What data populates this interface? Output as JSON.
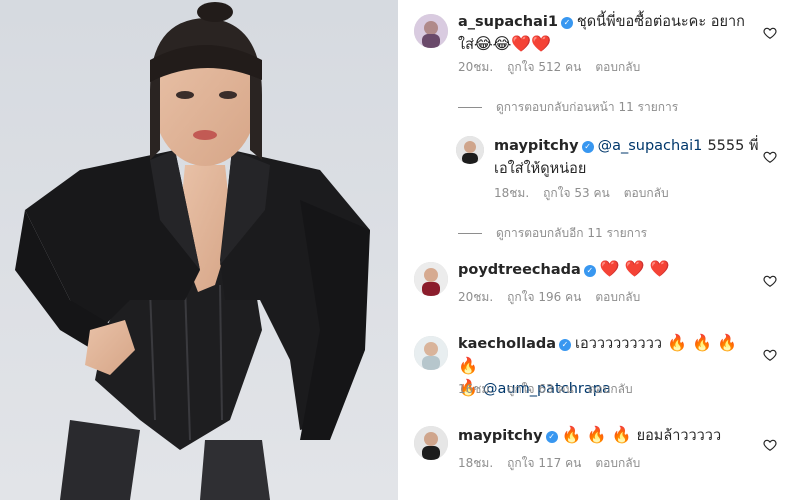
{
  "comments": [
    {
      "username": "a_supachai1",
      "text_line1": "ชุดนี้พี่ขอซื้อต่อนะคะ อยาก",
      "text_line2": "ใส่",
      "emojis": "😂😂",
      "hearts": "❤️❤️",
      "time": "20ชม.",
      "likes": "ถูกใจ 512 คน",
      "reply": "ตอบกลับ",
      "view_replies": "ดูการตอบกลับก่อนหน้า 11 รายการ"
    },
    {
      "username": "maypitchy",
      "mention": "@a_supachai1",
      "text_line1": "5555 พี่",
      "text_line2": "เอใส่ให้ดูหน่อย",
      "time": "18ชม.",
      "likes": "ถูกใจ 53 คน",
      "reply": "ตอบกลับ",
      "view_replies": "ดูการตอบกลับอีก 11 รายการ"
    },
    {
      "username": "poydtreechada",
      "hearts": "❤️ ❤️ ❤️",
      "time": "20ชม.",
      "likes": "ถูกใจ 196 คน",
      "reply": "ตอบกลับ"
    },
    {
      "username": "kaechollada",
      "text_line1": "เอววววววววว",
      "fires_line1": "🔥 🔥 🔥 🔥",
      "fires_line2": "🔥",
      "mention": "@aum_patchrapa",
      "time": "16ชม.",
      "likes": "ถูกใจ 63 คน",
      "reply": "ตอบกลับ"
    },
    {
      "username": "maypitchy",
      "fires": "🔥 🔥 🔥",
      "text_line1": "ยอมล้าววววว",
      "time": "18ชม.",
      "likes": "ถูกใจ 117 คน",
      "reply": "ตอบกลับ"
    }
  ],
  "icons": {
    "verified": "verified-badge-icon",
    "like": "heart-outline-icon"
  },
  "colors": {
    "text": "#262626",
    "meta": "#8e8e8e",
    "verified": "#3897f0",
    "mention": "#00376b"
  }
}
